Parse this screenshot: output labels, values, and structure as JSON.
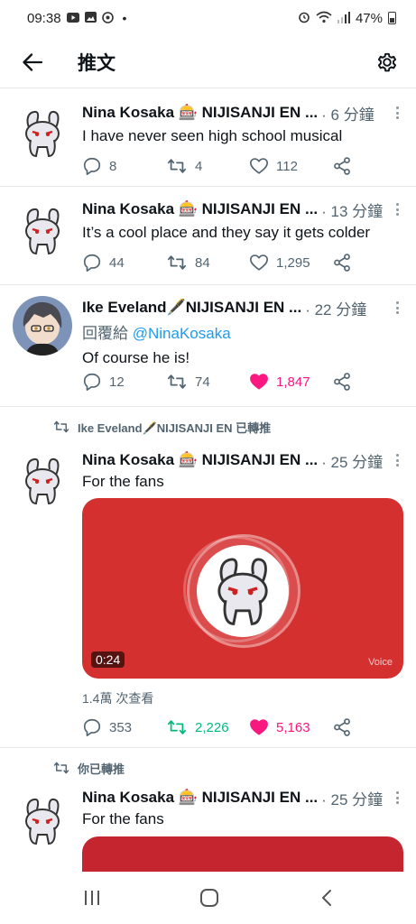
{
  "status_bar": {
    "time": "09:38",
    "dot": "•",
    "battery": "47%",
    "icons": [
      "youtube-icon",
      "gallery-icon",
      "app-icon",
      "alarm-icon",
      "wifi-icon",
      "signal-icon",
      "battery-icon"
    ]
  },
  "header": {
    "title": "推文",
    "icons": [
      "back-arrow-icon",
      "gear-icon"
    ]
  },
  "tweets": [
    {
      "name": "Nina Kosaka 🎰 NIJISANJI EN ...",
      "time": "· 6 分鐘",
      "text": "I have never seen high school musical",
      "replies": "8",
      "retweets": "4",
      "likes": "112",
      "liked": false,
      "retweeted": false
    },
    {
      "name": "Nina Kosaka 🎰 NIJISANJI EN ...",
      "time": "· 13 分鐘",
      "text": "It’s a cool place and they say it gets colder",
      "replies": "44",
      "retweets": "84",
      "likes": "1,295",
      "liked": false,
      "retweeted": false
    },
    {
      "name": "Ike Eveland🖋️NIJISANJI EN ...",
      "time": "· 22 分鐘",
      "reply_prefix": "回覆給 ",
      "reply_mention": "@NinaKosaka",
      "text": "Of course he is!",
      "replies": "12",
      "retweets": "74",
      "likes": "1,847",
      "liked": true,
      "retweeted": false
    },
    {
      "retweet_banner": "Ike Eveland🖋️NIJISANJI EN 已轉推",
      "name": "Nina Kosaka 🎰 NIJISANJI EN ...",
      "time": "· 25 分鐘",
      "text": "For the fans",
      "media_duration": "0:24",
      "media_label": "Voice",
      "views": "1.4萬 次查看",
      "replies": "353",
      "retweets": "2,226",
      "likes": "5,163",
      "liked": true,
      "retweeted": true
    },
    {
      "retweet_banner": "你已轉推",
      "name": "Nina Kosaka 🎰 NIJISANJI EN ...",
      "time": "· 25 分鐘",
      "text": "For the fans"
    }
  ],
  "colors": {
    "like_pink": "#f91880",
    "retweet_green": "#00ba7c",
    "link_blue": "#1d9bf0",
    "media_red": "#d4302f",
    "secondary_text": "#536471"
  },
  "navbar": {
    "icons": [
      "recents-icon",
      "home-icon",
      "back-icon"
    ]
  }
}
